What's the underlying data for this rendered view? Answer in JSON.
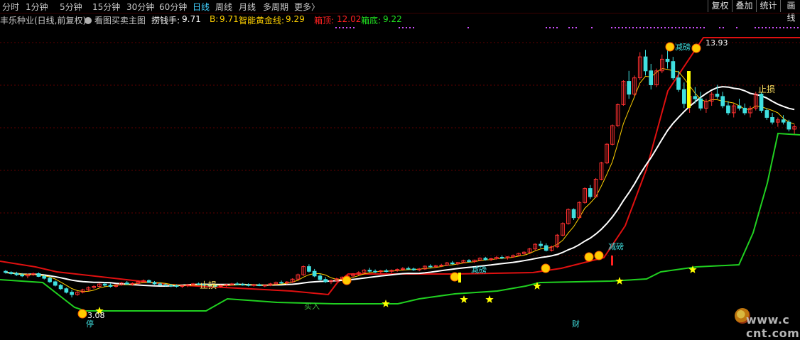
{
  "toolbar": {
    "periods": [
      "分时",
      "1分钟",
      "5分钟",
      "15分钟",
      "30分钟",
      "60分钟",
      "日线",
      "周线",
      "月线",
      "多周期",
      "更多〉"
    ],
    "active_period": "日线",
    "right_buttons": [
      "复权",
      "叠加",
      "统计",
      "画线"
    ]
  },
  "info": {
    "stock": "丰乐种业(日线,前复权)",
    "main_chart": "看图买卖主图",
    "lqs_label": "捞钱手:",
    "lqs_value": "9.71",
    "b_label": "B:",
    "b_value": "9.71",
    "gold_label": "智能黄金线:",
    "gold_value": "9.29",
    "top_label": "箱顶:",
    "top_value": "12.02",
    "bottom_label": "箱底:",
    "bottom_value": "9.22"
  },
  "annotations": {
    "stop_loss_1": "止损",
    "stop_loss_2": "止损",
    "reduce_1": "减磅",
    "reduce_2": "减磅",
    "reduce_3": "减磅",
    "buy_label": "买入",
    "low_price": "3.08",
    "high_price": "13.93",
    "stop_bottom": "停",
    "cai_label": "财"
  },
  "watermark": {
    "text": "www.c  cnt.com"
  },
  "colors": {
    "background": "#000000",
    "up": "#ff3030",
    "down": "#40e0e0",
    "ma_white": "#ffffff",
    "box_top": "#e01010",
    "box_bottom": "#20d020",
    "gold": "#ffd000",
    "grid": "#600000",
    "purple": "#d050ff"
  },
  "chart_data": {
    "type": "candlestick",
    "title": "",
    "y_range_estimate": [
      2.5,
      14.5
    ],
    "low_label_value": 3.08,
    "high_label_value": 13.93,
    "box_top_value": 12.02,
    "box_bottom_value": 9.22,
    "candles": [
      [
        4.2,
        4.25,
        4.1,
        4.15
      ],
      [
        4.15,
        4.2,
        4.05,
        4.1
      ],
      [
        4.1,
        4.18,
        4.0,
        4.05
      ],
      [
        4.05,
        4.12,
        3.95,
        4.0
      ],
      [
        4.0,
        4.1,
        3.9,
        4.05
      ],
      [
        4.05,
        4.15,
        4.0,
        4.1
      ],
      [
        4.1,
        4.15,
        3.95,
        3.98
      ],
      [
        3.98,
        4.05,
        3.85,
        3.9
      ],
      [
        3.9,
        3.95,
        3.7,
        3.75
      ],
      [
        3.75,
        3.8,
        3.55,
        3.6
      ],
      [
        3.6,
        3.65,
        3.4,
        3.45
      ],
      [
        3.45,
        3.5,
        3.25,
        3.3
      ],
      [
        3.3,
        3.4,
        3.08,
        3.2
      ],
      [
        3.2,
        3.35,
        3.15,
        3.3
      ],
      [
        3.3,
        3.45,
        3.25,
        3.4
      ],
      [
        3.4,
        3.55,
        3.35,
        3.5
      ],
      [
        3.5,
        3.6,
        3.45,
        3.55
      ],
      [
        3.55,
        3.7,
        3.5,
        3.65
      ],
      [
        3.65,
        3.72,
        3.55,
        3.6
      ],
      [
        3.6,
        3.68,
        3.5,
        3.55
      ],
      [
        3.55,
        3.65,
        3.5,
        3.62
      ],
      [
        3.62,
        3.75,
        3.58,
        3.7
      ],
      [
        3.7,
        3.78,
        3.62,
        3.65
      ],
      [
        3.65,
        3.72,
        3.58,
        3.68
      ],
      [
        3.68,
        3.8,
        3.65,
        3.75
      ],
      [
        3.75,
        3.85,
        3.7,
        3.8
      ],
      [
        3.8,
        3.85,
        3.7,
        3.72
      ],
      [
        3.72,
        3.78,
        3.62,
        3.66
      ],
      [
        3.66,
        3.72,
        3.58,
        3.62
      ],
      [
        3.62,
        3.68,
        3.55,
        3.6
      ],
      [
        3.6,
        3.66,
        3.52,
        3.58
      ],
      [
        3.58,
        3.64,
        3.5,
        3.55
      ],
      [
        3.55,
        3.62,
        3.48,
        3.58
      ],
      [
        3.58,
        3.66,
        3.52,
        3.62
      ],
      [
        3.62,
        3.7,
        3.58,
        3.66
      ],
      [
        3.66,
        3.72,
        3.6,
        3.64
      ],
      [
        3.64,
        3.7,
        3.56,
        3.6
      ],
      [
        3.6,
        3.66,
        3.54,
        3.58
      ],
      [
        3.58,
        3.64,
        3.5,
        3.56
      ],
      [
        3.56,
        3.62,
        3.5,
        3.58
      ],
      [
        3.58,
        3.66,
        3.54,
        3.62
      ],
      [
        3.62,
        3.7,
        3.58,
        3.66
      ],
      [
        3.66,
        3.74,
        3.6,
        3.64
      ],
      [
        3.64,
        3.7,
        3.58,
        3.62
      ],
      [
        3.62,
        3.68,
        3.55,
        3.6
      ],
      [
        3.6,
        3.66,
        3.54,
        3.62
      ],
      [
        3.62,
        3.68,
        3.56,
        3.58
      ],
      [
        3.58,
        3.64,
        3.52,
        3.6
      ],
      [
        3.6,
        3.7,
        3.56,
        3.66
      ],
      [
        3.66,
        3.76,
        3.62,
        3.72
      ],
      [
        3.72,
        3.8,
        3.66,
        3.7
      ],
      [
        3.7,
        3.78,
        3.64,
        3.74
      ],
      [
        3.74,
        3.9,
        3.7,
        3.86
      ],
      [
        3.86,
        4.1,
        3.82,
        4.05
      ],
      [
        4.05,
        4.45,
        4.0,
        4.4
      ],
      [
        4.4,
        4.5,
        4.15,
        4.2
      ],
      [
        4.2,
        4.3,
        3.95,
        4.0
      ],
      [
        4.0,
        4.1,
        3.8,
        3.85
      ],
      [
        3.85,
        3.95,
        3.7,
        3.75
      ],
      [
        3.75,
        3.85,
        3.65,
        3.8
      ],
      [
        3.8,
        3.92,
        3.75,
        3.88
      ],
      [
        3.88,
        3.98,
        3.82,
        3.95
      ],
      [
        3.95,
        4.05,
        3.88,
        4.0
      ],
      [
        4.0,
        4.12,
        3.95,
        4.08
      ],
      [
        4.08,
        4.2,
        4.02,
        4.15
      ],
      [
        4.15,
        4.3,
        4.1,
        4.25
      ],
      [
        4.25,
        4.35,
        4.15,
        4.2
      ],
      [
        4.2,
        4.28,
        4.12,
        4.18
      ],
      [
        4.18,
        4.26,
        4.1,
        4.22
      ],
      [
        4.22,
        4.3,
        4.15,
        4.2
      ],
      [
        4.2,
        4.28,
        4.12,
        4.24
      ],
      [
        4.24,
        4.32,
        4.18,
        4.28
      ],
      [
        4.28,
        4.38,
        4.22,
        4.32
      ],
      [
        4.32,
        4.4,
        4.26,
        4.3
      ],
      [
        4.3,
        4.36,
        4.22,
        4.26
      ],
      [
        4.26,
        4.34,
        4.2,
        4.3
      ],
      [
        4.3,
        4.45,
        4.26,
        4.42
      ],
      [
        4.42,
        4.5,
        4.35,
        4.4
      ],
      [
        4.4,
        4.48,
        4.34,
        4.44
      ],
      [
        4.44,
        4.52,
        4.38,
        4.46
      ],
      [
        4.46,
        4.6,
        4.42,
        4.56
      ],
      [
        4.56,
        4.64,
        4.48,
        4.52
      ],
      [
        4.52,
        4.6,
        4.46,
        4.58
      ],
      [
        4.58,
        4.7,
        4.54,
        4.66
      ],
      [
        4.66,
        4.72,
        4.58,
        4.62
      ],
      [
        4.62,
        4.7,
        4.56,
        4.68
      ],
      [
        4.68,
        4.8,
        4.64,
        4.76
      ],
      [
        4.76,
        4.82,
        4.66,
        4.7
      ],
      [
        4.7,
        4.78,
        4.64,
        4.74
      ],
      [
        4.74,
        4.86,
        4.7,
        4.8
      ],
      [
        4.8,
        4.88,
        4.72,
        4.78
      ],
      [
        4.78,
        4.84,
        4.7,
        4.82
      ],
      [
        4.82,
        4.92,
        4.78,
        4.88
      ],
      [
        4.88,
        5.0,
        4.84,
        4.96
      ],
      [
        4.96,
        5.06,
        4.9,
        5.02
      ],
      [
        5.02,
        5.2,
        4.98,
        5.16
      ],
      [
        5.16,
        5.4,
        5.1,
        5.36
      ],
      [
        5.36,
        5.5,
        5.2,
        5.3
      ],
      [
        5.3,
        5.4,
        5.05,
        5.1
      ],
      [
        5.1,
        5.3,
        5.05,
        5.25
      ],
      [
        5.25,
        5.8,
        5.2,
        5.75
      ],
      [
        5.75,
        6.3,
        5.7,
        6.25
      ],
      [
        6.25,
        6.9,
        6.2,
        6.85
      ],
      [
        6.85,
        6.9,
        6.4,
        6.5
      ],
      [
        6.5,
        7.2,
        6.45,
        7.15
      ],
      [
        7.15,
        7.8,
        7.1,
        7.75
      ],
      [
        7.75,
        7.9,
        7.3,
        7.4
      ],
      [
        7.4,
        8.2,
        7.35,
        8.15
      ],
      [
        8.15,
        8.9,
        8.1,
        8.85
      ],
      [
        8.85,
        9.7,
        8.8,
        9.65
      ],
      [
        9.65,
        10.5,
        9.6,
        10.45
      ],
      [
        10.45,
        11.4,
        10.4,
        11.35
      ],
      [
        11.35,
        12.4,
        11.3,
        12.35
      ],
      [
        12.35,
        12.8,
        11.6,
        11.8
      ],
      [
        11.8,
        12.6,
        11.7,
        12.5
      ],
      [
        12.5,
        13.6,
        12.4,
        13.4
      ],
      [
        13.4,
        13.7,
        12.6,
        12.8
      ],
      [
        12.8,
        13.1,
        12.0,
        12.2
      ],
      [
        12.2,
        12.9,
        12.1,
        12.8
      ],
      [
        12.8,
        13.5,
        12.7,
        13.3
      ],
      [
        13.3,
        13.93,
        12.9,
        13.2
      ],
      [
        13.2,
        13.4,
        12.4,
        12.5
      ],
      [
        12.5,
        12.8,
        11.9,
        12.0
      ],
      [
        12.0,
        12.3,
        11.2,
        11.4
      ],
      [
        11.4,
        11.8,
        11.0,
        11.7
      ],
      [
        11.7,
        12.1,
        11.4,
        11.6
      ],
      [
        11.6,
        11.9,
        11.1,
        11.2
      ],
      [
        11.2,
        11.6,
        11.0,
        11.5
      ],
      [
        11.5,
        11.9,
        11.3,
        11.8
      ],
      [
        11.8,
        12.2,
        11.6,
        11.7
      ],
      [
        11.7,
        11.9,
        11.2,
        11.3
      ],
      [
        11.3,
        11.5,
        10.9,
        11.0
      ],
      [
        11.0,
        11.4,
        10.8,
        11.3
      ],
      [
        11.3,
        11.6,
        11.1,
        11.2
      ],
      [
        11.2,
        11.4,
        10.9,
        11.0
      ],
      [
        11.0,
        11.3,
        10.8,
        11.2
      ],
      [
        11.2,
        11.9,
        11.1,
        11.8
      ],
      [
        11.8,
        11.9,
        11.0,
        11.1
      ],
      [
        11.1,
        11.2,
        10.7,
        10.8
      ],
      [
        10.8,
        11.0,
        10.5,
        10.6
      ],
      [
        10.6,
        10.8,
        10.4,
        10.7
      ],
      [
        10.7,
        10.9,
        10.5,
        10.6
      ],
      [
        10.6,
        10.7,
        10.2,
        10.3
      ],
      [
        10.3,
        10.5,
        10.1,
        10.4
      ]
    ]
  }
}
